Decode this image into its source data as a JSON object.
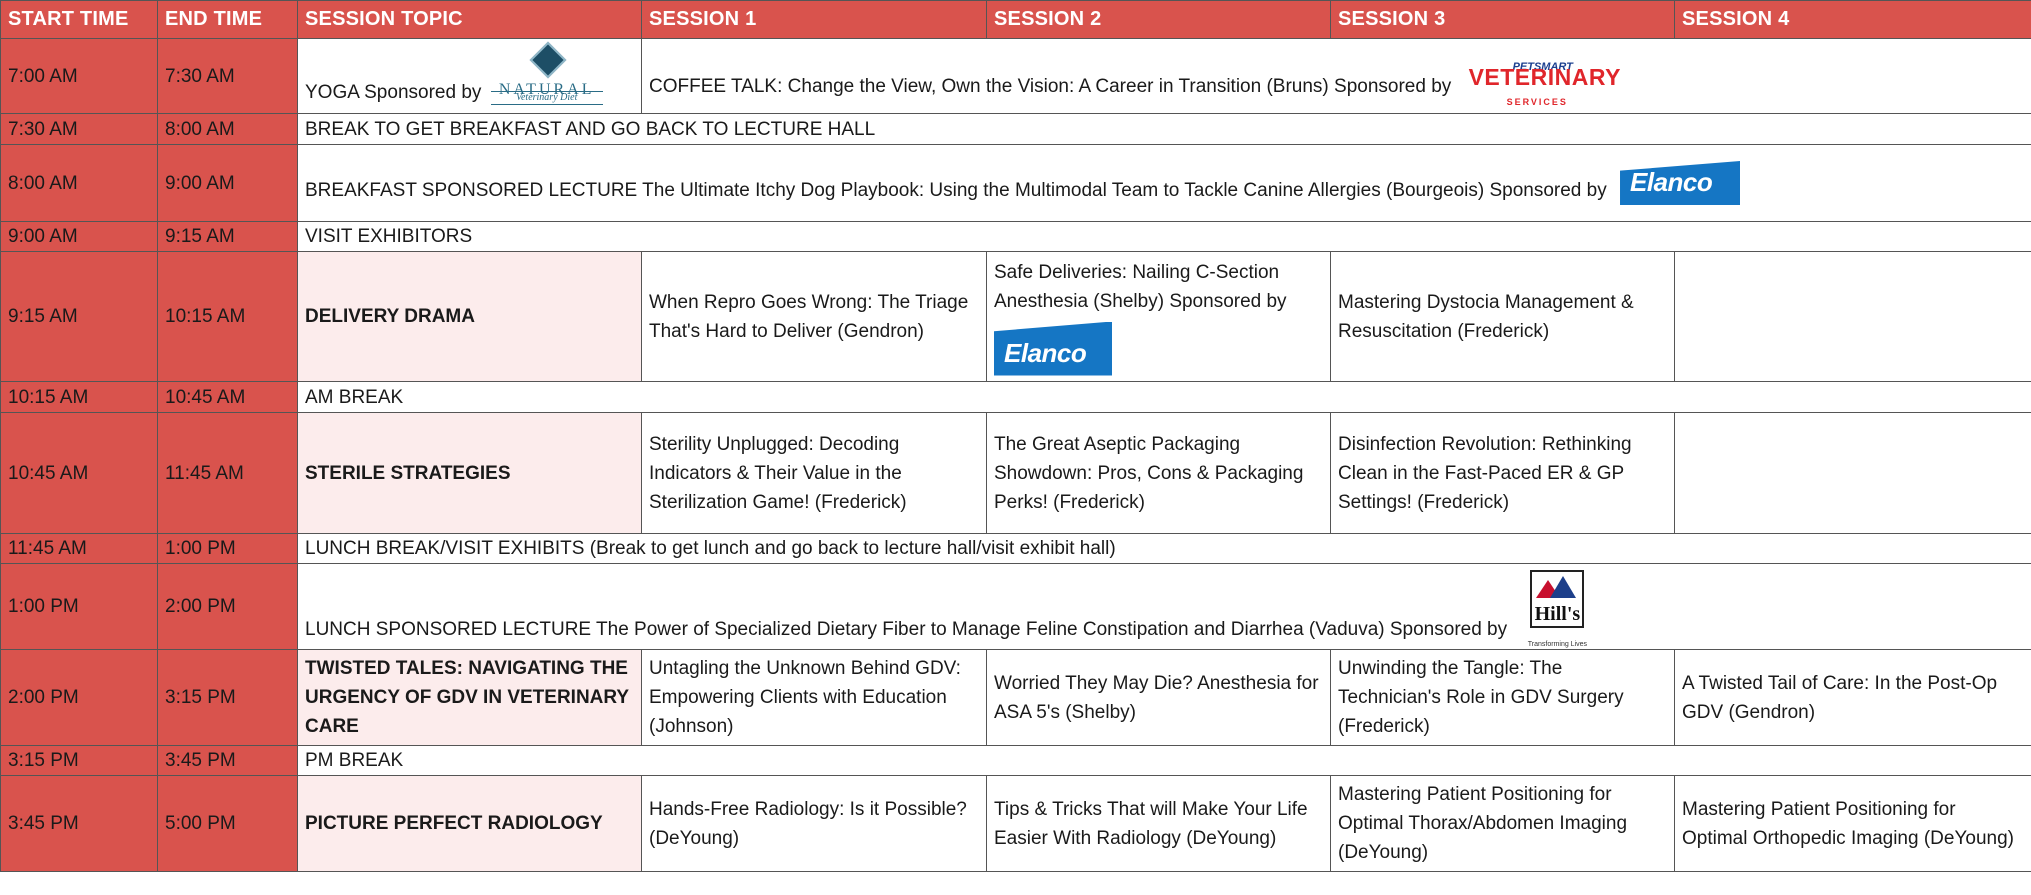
{
  "headers": {
    "start_time": "START TIME",
    "end_time": "END TIME",
    "session_topic": "SESSION TOPIC",
    "session_1": "SESSION 1",
    "session_2": "SESSION 2",
    "session_3": "SESSION 3",
    "session_4": "SESSION 4"
  },
  "rows": [
    {
      "start": "7:00 AM",
      "end": "7:30 AM",
      "yoga": "YOGA Sponsored by",
      "coffee": "COFFEE TALK: Change the View, Own the Vision: A Career in Transition (Bruns) Sponsored by"
    },
    {
      "start": "7:30 AM",
      "end": "8:00 AM",
      "text": "BREAK TO GET BREAKFAST AND GO BACK TO LECTURE HALL"
    },
    {
      "start": "8:00 AM",
      "end": "9:00 AM",
      "text": "BREAKFAST SPONSORED LECTURE The Ultimate Itchy Dog Playbook: Using the Multimodal Team to Tackle Canine Allergies (Bourgeois) Sponsored by"
    },
    {
      "start": "9:00 AM",
      "end": "9:15 AM",
      "text": "VISIT EXHIBITORS"
    },
    {
      "start": "9:15 AM",
      "end": "10:15 AM",
      "topic": "DELIVERY DRAMA",
      "s1": "When Repro Goes Wrong: The Triage That's Hard to Deliver (Gendron)",
      "s2": "Safe Deliveries: Nailing C-Section Anesthesia (Shelby) Sponsored by",
      "s3": "Mastering Dystocia Management & Resuscitation (Frederick)",
      "s4": ""
    },
    {
      "start": "10:15 AM",
      "end": "10:45 AM",
      "text": "AM BREAK"
    },
    {
      "start": "10:45 AM",
      "end": "11:45 AM",
      "topic": "STERILE STRATEGIES",
      "s1": "Sterility Unplugged: Decoding Indicators & Their Value in the Sterilization Game! (Frederick)",
      "s2": "The Great Aseptic Packaging Showdown: Pros, Cons & Packaging Perks! (Frederick)",
      "s3": "Disinfection Revolution: Rethinking Clean in the Fast-Paced ER & GP Settings! (Frederick)",
      "s4": ""
    },
    {
      "start": "11:45 AM",
      "end": "1:00 PM",
      "text": "LUNCH BREAK/VISIT EXHIBITS (Break to get lunch and go back to lecture hall/visit exhibit hall)"
    },
    {
      "start": "1:00 PM",
      "end": "2:00 PM",
      "text": "LUNCH SPONSORED LECTURE The Power of Specialized Dietary Fiber to Manage Feline Constipation and Diarrhea (Vaduva) Sponsored by"
    },
    {
      "start": "2:00 PM",
      "end": "3:15 PM",
      "topic": "TWISTED TALES: NAVIGATING THE URGENCY OF GDV IN VETERINARY CARE",
      "s1": "Untagling the Unknown Behind GDV: Empowering Clients with Education (Johnson)",
      "s2": "Worried They May Die? Anesthesia for ASA 5's (Shelby)",
      "s3": "Unwinding the Tangle: The Technician's Role in GDV Surgery (Frederick)",
      "s4": "A Twisted Tail of Care: In the Post-Op GDV (Gendron)"
    },
    {
      "start": "3:15 PM",
      "end": "3:45 PM",
      "text": "PM BREAK"
    },
    {
      "start": "3:45 PM",
      "end": "5:00 PM",
      "topic": "PICTURE PERFECT RADIOLOGY",
      "s1": "Hands-Free Radiology: Is it Possible? (DeYoung)",
      "s2": "Tips & Tricks That will Make Your Life Easier With Radiology (DeYoung)",
      "s3": "Mastering Patient Positioning for Optimal Thorax/Abdomen Imaging (DeYoung)",
      "s4": "Mastering Patient Positioning for Optimal Orthopedic Imaging (DeYoung)"
    }
  ],
  "logos": {
    "natural_word": "NATURAL",
    "natural_sub": "Veterinary Diet",
    "petsmart_brand": "PETSMART",
    "petsmart_vet": "VETERINARY",
    "petsmart_services": "SERVICES",
    "elanco": "Elanco",
    "hills": "Hill's",
    "hills_tagline": "Transforming Lives"
  },
  "colors": {
    "header_red": "#d9534d",
    "topic_pink": "#fcecec",
    "elanco_blue": "#1576c4",
    "petsmart_red": "#e0262b"
  }
}
